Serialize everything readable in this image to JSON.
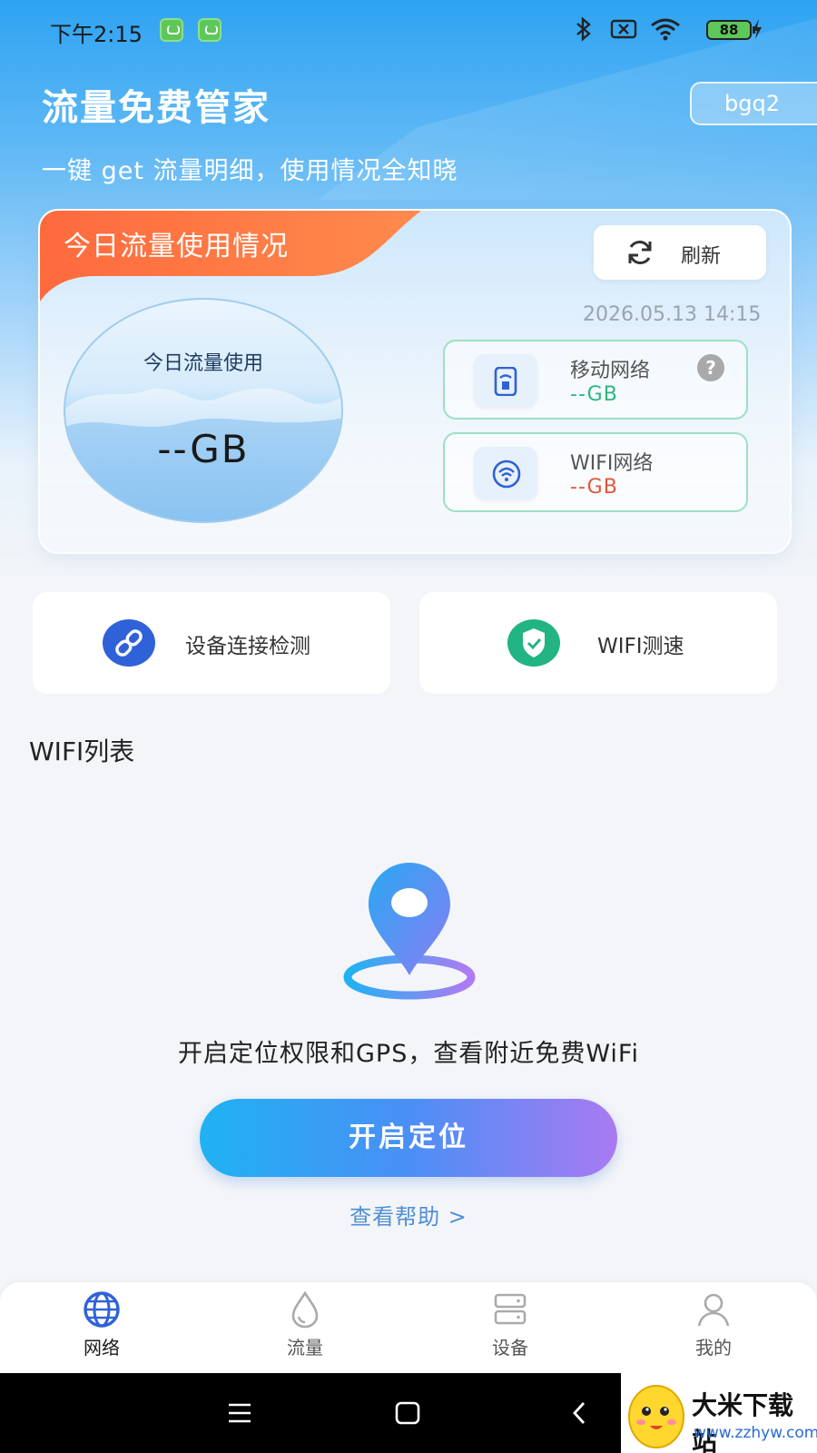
{
  "status_bar": {
    "time": "下午2:15",
    "battery": "88"
  },
  "header": {
    "title": "流量免费管家",
    "user": "bgq2",
    "subtitle": "一键 get 流量明细，使用情况全知晓"
  },
  "usage_card": {
    "tab_label": "今日流量使用情况",
    "refresh_label": "刷新",
    "timestamp": "2026.05.13 14:15",
    "today_label": "今日流量使用",
    "today_value": "--GB",
    "mobile": {
      "name": "移动网络",
      "value": "--GB",
      "help": "?"
    },
    "wifi": {
      "name": "WIFI网络",
      "value": "--GB"
    }
  },
  "tools": [
    {
      "label": "设备连接检测",
      "icon": "link-icon"
    },
    {
      "label": "WIFI测速",
      "icon": "shield-check-icon"
    }
  ],
  "wifi_list": {
    "title": "WIFI列表",
    "empty_message": "开启定位权限和GPS，查看附近免费WiFi",
    "button_label": "开启定位",
    "help_link": "查看帮助 >"
  },
  "bottom_nav": [
    {
      "label": "网络",
      "icon": "globe-icon",
      "active": true
    },
    {
      "label": "流量",
      "icon": "drop-icon",
      "active": false
    },
    {
      "label": "设备",
      "icon": "server-icon",
      "active": false
    },
    {
      "label": "我的",
      "icon": "user-icon",
      "active": false
    }
  ],
  "watermark": {
    "name": "大米下载站",
    "url": "www.zzhyw.com"
  },
  "colors": {
    "accent_blue": "#2ea3f2",
    "tab_orange": "#ff6a3d",
    "green": "#2cb67d",
    "red": "#e2573b",
    "link_blue": "#2f62d8"
  }
}
